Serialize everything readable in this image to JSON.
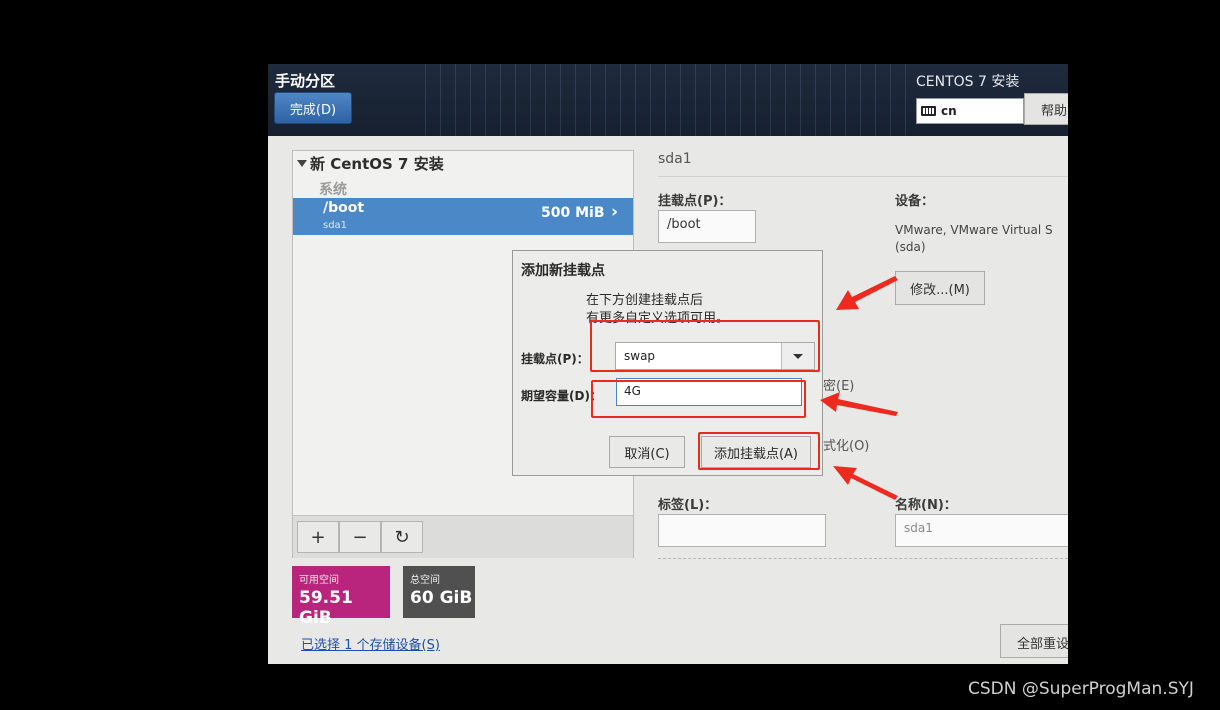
{
  "header": {
    "title": "手动分区",
    "done_button": "完成(D)",
    "installer_title": "CENTOS 7 安装",
    "keyboard_layout": "cn",
    "help_button": "帮助"
  },
  "tree": {
    "group_title": "新 CentOS 7 安装",
    "section_label": "系统",
    "rows": [
      {
        "mount_point": "/boot",
        "device": "sda1",
        "size": "500 MiB",
        "selected": true
      }
    ],
    "toolbar": {
      "add": "+",
      "remove": "−",
      "refresh": "↻"
    }
  },
  "space": {
    "available_label": "可用空间",
    "available_value": "59.51 GiB",
    "total_label": "总空间",
    "total_value": "60 GiB"
  },
  "storage_link": "已选择 1 个存储设备(S)",
  "detail": {
    "section_title": "sda1",
    "mount_point_label": "挂载点(P)：",
    "mount_point_value": "/boot",
    "device_label": "设备：",
    "device_text_line1": "VMware, VMware Virtual S",
    "device_text_line2": "(sda)",
    "modify_button": "修改...(M)",
    "encrypt_partial": "密(E)",
    "reformat_partial": "式化(O)",
    "label_label": "标签(L)：",
    "label_value": "",
    "name_label": "名称(N)：",
    "name_placeholder": "sda1",
    "reset_all_button": "全部重设"
  },
  "dialog": {
    "title": "添加新挂载点",
    "desc_line1": "在下方创建挂载点后",
    "desc_line2": "有更多自定义选项可用。",
    "mount_label": "挂载点(P)：",
    "mount_value": "swap",
    "capacity_label": "期望容量(D)：",
    "capacity_value": "4G",
    "cancel_button": "取消(C)",
    "add_button": "添加挂载点(A)"
  },
  "watermark": "CSDN @SuperProgMan.SYJ",
  "colors": {
    "annotation_red": "#ee2a1f",
    "selection_blue": "#4a88c8",
    "available_magenta": "#b9247c",
    "total_gray": "#505050"
  }
}
